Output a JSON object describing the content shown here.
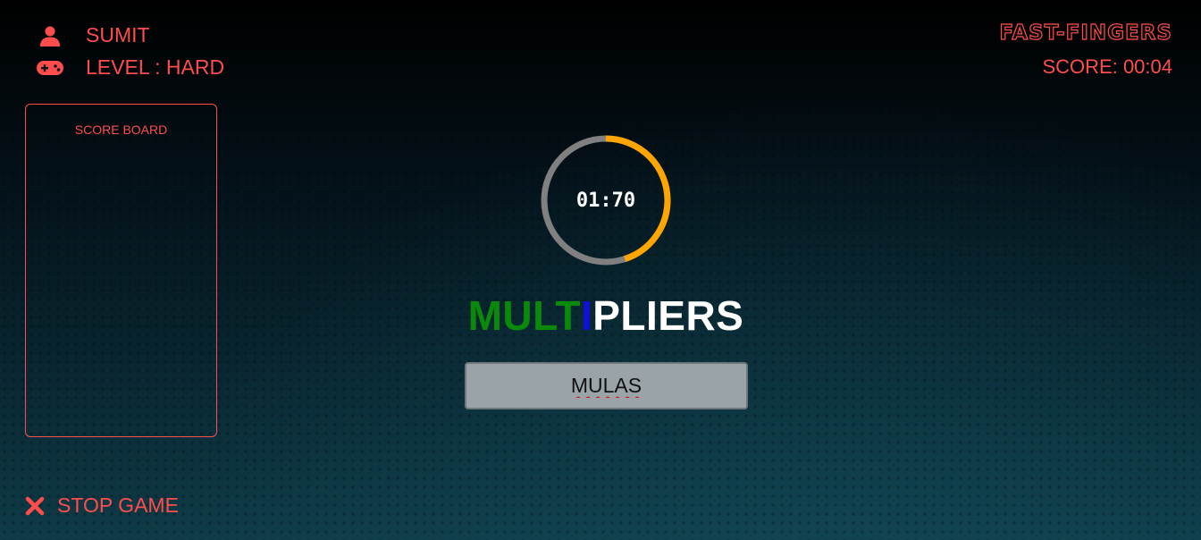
{
  "player": {
    "name": "SUMIT",
    "level_text": "LEVEL : HARD"
  },
  "brand": {
    "title": "FAST-FINGERS"
  },
  "score": {
    "text": "SCORE: 00:04"
  },
  "scoreboard": {
    "title": "SCORE BOARD"
  },
  "timer": {
    "display": "01:70",
    "remaining_fraction": 0.45,
    "track_color": "#808080",
    "progress_color": "#ffa500"
  },
  "word": {
    "segments": [
      {
        "text": "MULT",
        "color": "#0a8a0a"
      },
      {
        "text": "I",
        "color": "#1010dd"
      },
      {
        "text": "PLIERS",
        "color": "#ffffff"
      }
    ]
  },
  "answer": {
    "value": "MULAS"
  },
  "controls": {
    "stop_label": "STOP GAME"
  },
  "icons": {
    "user": "user-icon",
    "level": "gamepad-icon",
    "stop": "close-icon"
  },
  "colors": {
    "accent": "#ff4d4d"
  }
}
